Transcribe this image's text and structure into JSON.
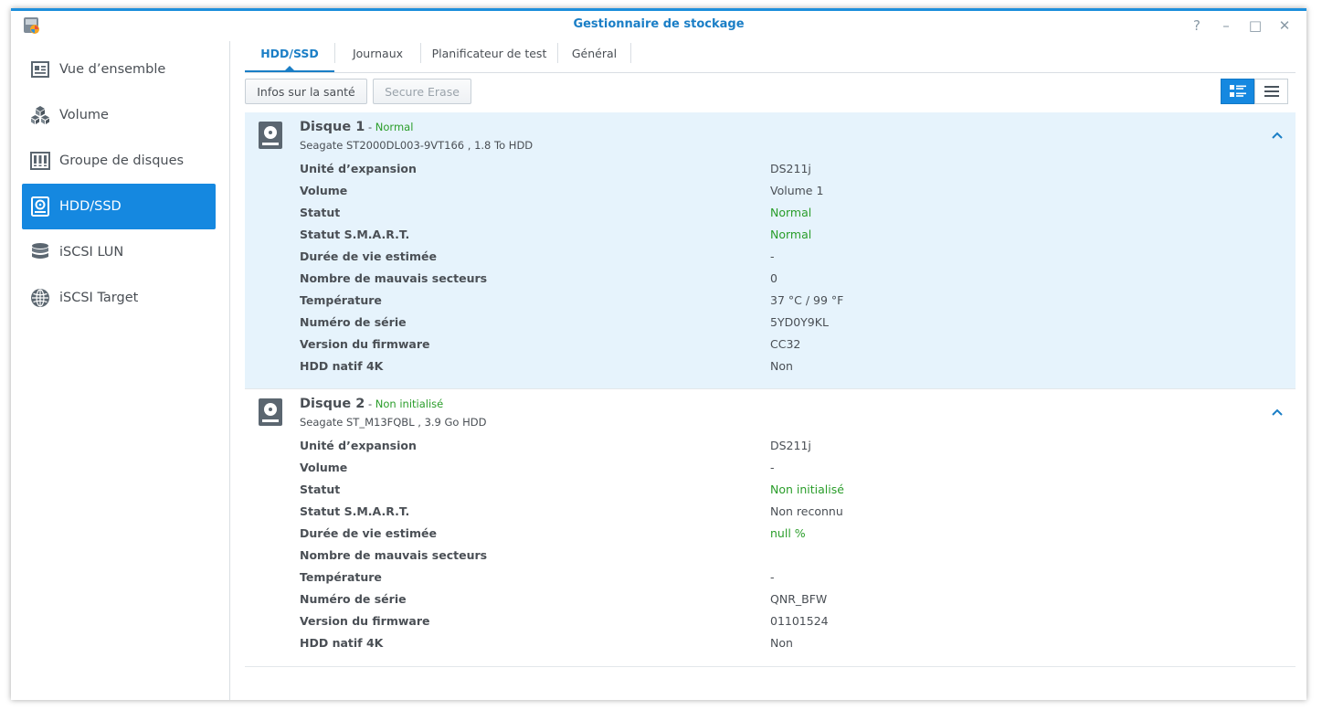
{
  "window": {
    "title": "Gestionnaire de stockage",
    "accent": "#1588e0",
    "help_glyph": "?",
    "minimize_glyph": "–",
    "maximize_glyph": "□",
    "close_glyph": "✕"
  },
  "sidebar": {
    "items": [
      {
        "label": "Vue d’ensemble",
        "icon": "overview-icon"
      },
      {
        "label": "Volume",
        "icon": "cubes-icon"
      },
      {
        "label": "Groupe de disques",
        "icon": "disk-group-icon"
      },
      {
        "label": "HDD/SSD",
        "icon": "hdd-icon",
        "active": true
      },
      {
        "label": "iSCSI LUN",
        "icon": "database-icon"
      },
      {
        "label": "iSCSI Target",
        "icon": "globe-icon"
      }
    ]
  },
  "tabs": [
    {
      "label": "HDD/SSD",
      "active": true
    },
    {
      "label": "Journaux"
    },
    {
      "label": "Planificateur de test"
    },
    {
      "label": "Général"
    }
  ],
  "toolbar": {
    "health_label": "Infos sur la santé",
    "secure_erase_label": "Secure Erase",
    "view_mode": "detail"
  },
  "disks": [
    {
      "name": "Disque 1",
      "separator": " - ",
      "status": "Normal",
      "model": "Seagate ST2000DL003-9VT166 , 1.8 To HDD",
      "rows": [
        {
          "key": "Unité d’expansion",
          "value": "DS211j"
        },
        {
          "key": "Volume",
          "value": "Volume 1"
        },
        {
          "key": "Statut",
          "value": "Normal",
          "green": true
        },
        {
          "key": "Statut S.M.A.R.T.",
          "value": "Normal",
          "green": true
        },
        {
          "key": "Durée de vie estimée",
          "value": "-"
        },
        {
          "key": "Nombre de mauvais secteurs",
          "value": "0"
        },
        {
          "key": "Température",
          "value": "37 °C / 99 °F"
        },
        {
          "key": "Numéro de série",
          "value": "5YD0Y9KL"
        },
        {
          "key": "Version du firmware",
          "value": "CC32"
        },
        {
          "key": "HDD natif 4K",
          "value": "Non"
        }
      ]
    },
    {
      "name": "Disque 2",
      "separator": " - ",
      "status": "Non initialisé",
      "model": "Seagate ST_M13FQBL , 3.9 Go HDD",
      "rows": [
        {
          "key": "Unité d’expansion",
          "value": "DS211j"
        },
        {
          "key": "Volume",
          "value": "-"
        },
        {
          "key": "Statut",
          "value": "Non initialisé",
          "green": true
        },
        {
          "key": "Statut S.M.A.R.T.",
          "value": "Non reconnu"
        },
        {
          "key": "Durée de vie estimée",
          "value": "null %",
          "green": true
        },
        {
          "key": "Nombre de mauvais secteurs",
          "value": ""
        },
        {
          "key": "Température",
          "value": "-"
        },
        {
          "key": "Numéro de série",
          "value": "QNR_BFW"
        },
        {
          "key": "Version du firmware",
          "value": "01101524"
        },
        {
          "key": "HDD natif 4K",
          "value": "Non"
        }
      ]
    }
  ]
}
